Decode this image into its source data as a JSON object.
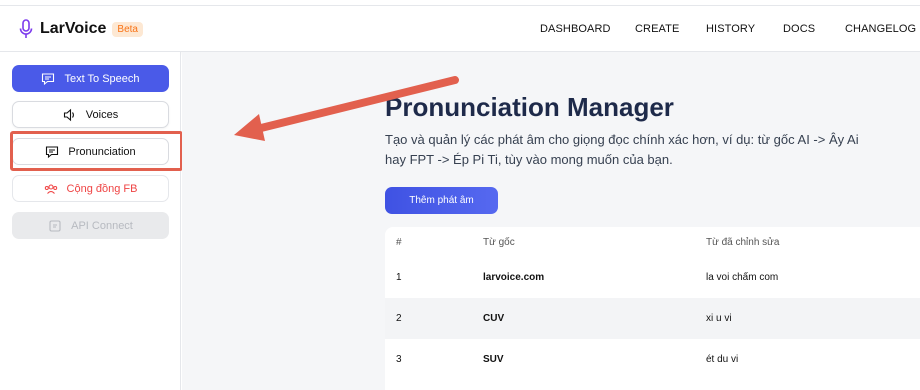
{
  "app": {
    "name": "LarVoice",
    "badge": "Beta"
  },
  "nav": [
    "DASHBOARD",
    "CREATE",
    "HISTORY",
    "DOCS",
    "CHANGELOG"
  ],
  "sidebar": {
    "items": [
      {
        "label": "Text To Speech",
        "icon": "chat-icon",
        "active": true
      },
      {
        "label": "Voices",
        "icon": "speaker-icon"
      },
      {
        "label": "Pronunciation",
        "icon": "chat-icon",
        "highlighted": true
      },
      {
        "label": "Cộng đồng FB",
        "icon": "group-icon"
      },
      {
        "label": "API Connect",
        "icon": "api-icon",
        "disabled": true
      }
    ]
  },
  "main": {
    "title": "Pronunciation Manager",
    "description": "Tạo và quản lý các phát âm cho giọng đọc chính xác hơn, ví dụ: từ gốc AI -> Ây Ai hay FPT -> Ép Pi Ti, tùy vào mong muốn của bạn.",
    "add_button": "Thêm phát âm",
    "table": {
      "headers": [
        "#",
        "Từ gốc",
        "Từ đã chỉnh sửa"
      ],
      "rows": [
        [
          "1",
          "larvoice.com",
          "la voi chấm com"
        ],
        [
          "2",
          "CUV",
          "xi u vi"
        ],
        [
          "3",
          "SUV",
          "ét du vi"
        ]
      ]
    }
  },
  "colors": {
    "accent": "#4a5ae8",
    "annotation": "#e2604e",
    "danger": "#ef4444"
  }
}
